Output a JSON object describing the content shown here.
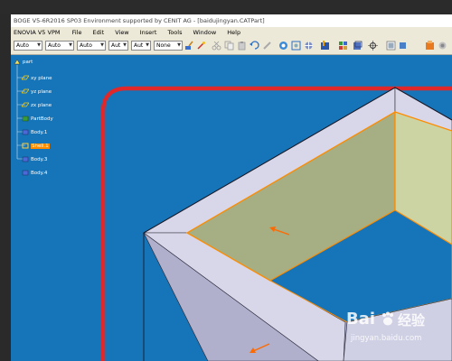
{
  "window": {
    "title": "BOGE V5-6R2016 SP03 Environment supported by CENIT AG - [baidujingyan.CATPart]"
  },
  "menu": {
    "brand": "ENOVIA V5 VPM",
    "items": [
      "File",
      "Edit",
      "View",
      "Insert",
      "Tools",
      "Window",
      "Help"
    ]
  },
  "toolbar": {
    "selects": [
      "Auto",
      "Auto",
      "Auto",
      "Aut",
      "Aut",
      "None"
    ]
  },
  "tree": {
    "root": "part",
    "items": [
      "xy plane",
      "yz plane",
      "zx plane",
      "PartBody",
      "Body.1",
      "Shell.1",
      "Body.3",
      "Body.4"
    ],
    "highlighted": "Shell.1"
  },
  "watermark": {
    "brand": "Bai",
    "brand_cn": "经验",
    "url": "jingyan.baidu.com"
  },
  "colors": {
    "viewport_bg": "#1675b8",
    "shell_face": "#d7d7e9",
    "selected_face": "#a6ae84",
    "selection_edge": "#ff8c00",
    "boundary_red": "#e0282a"
  }
}
